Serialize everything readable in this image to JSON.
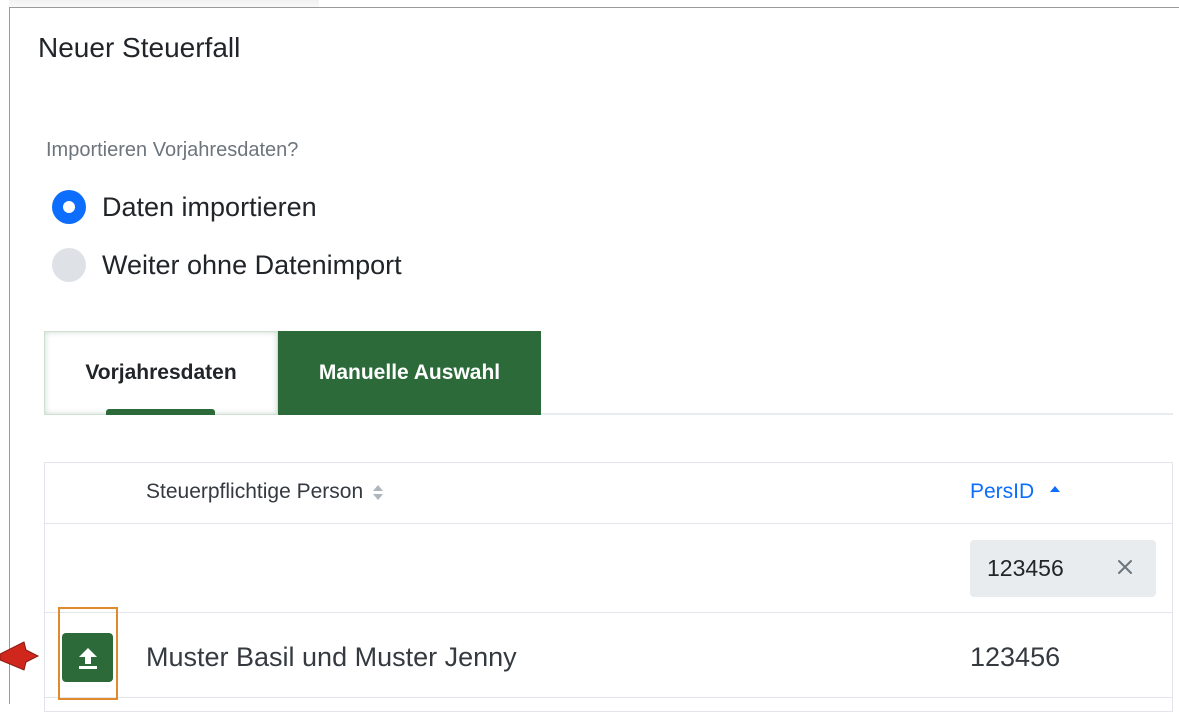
{
  "dialog": {
    "title": "Neuer Steuerfall"
  },
  "import_question": {
    "label": "Importieren Vorjahresdaten?",
    "options": [
      {
        "label": "Daten importieren",
        "checked": true
      },
      {
        "label": "Weiter ohne Datenimport",
        "checked": false
      }
    ]
  },
  "tabs": [
    {
      "label": "Vorjahresdaten",
      "active": true
    },
    {
      "label": "Manuelle Auswahl",
      "active": false
    }
  ],
  "table": {
    "columns": [
      {
        "label": "Steuerpflichtige Person",
        "sort": "none"
      },
      {
        "label": "PersID",
        "sort": "ascending"
      }
    ],
    "filter": {
      "persid_value": "123456"
    },
    "rows": [
      {
        "name": "Muster Basil und Muster Jenny",
        "persid": "123456",
        "action_icon": "upload-icon"
      }
    ]
  },
  "colors": {
    "primary": "#0d6efd",
    "brand_green": "#2d6a39",
    "highlight_orange": "#e08a2c",
    "pointer_red": "#d0271d"
  }
}
